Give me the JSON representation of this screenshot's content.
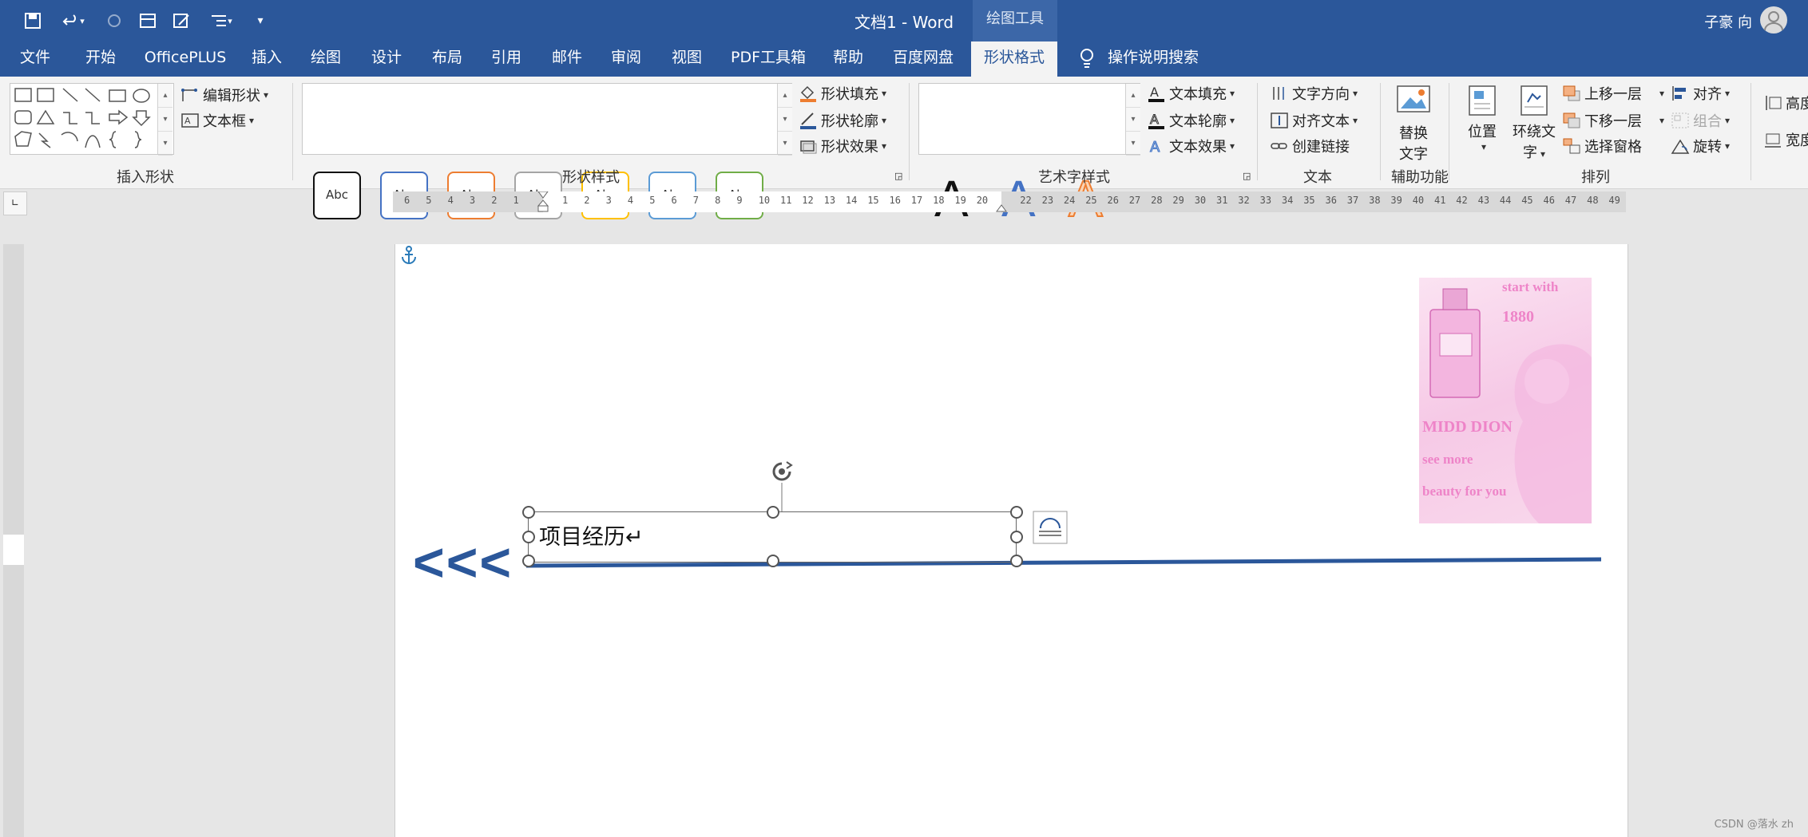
{
  "titlebar": {
    "doc_title": "文档1  -  Word",
    "context_group": "绘图工具",
    "user_name": "子豪 向",
    "qa_icons": [
      "save-icon",
      "undo-icon",
      "redo-icon",
      "table-icon",
      "edit-icon",
      "list-format-icon",
      "customize-icon"
    ]
  },
  "tabs": [
    "文件",
    "开始",
    "OfficePLUS",
    "插入",
    "绘图",
    "设计",
    "布局",
    "引用",
    "邮件",
    "审阅",
    "视图",
    "PDF工具箱",
    "帮助",
    "百度网盘",
    "形状格式"
  ],
  "active_tab": "形状格式",
  "tell_me": "操作说明搜索",
  "ribbon": {
    "insert_shapes": {
      "label": "插入形状",
      "edit_shape": "编辑形状",
      "text_box": "文本框"
    },
    "shape_styles": {
      "label": "形状样式",
      "abc": "Abc",
      "fill": "形状填充",
      "outline": "形状轮廓",
      "effects": "形状效果"
    },
    "wordart": {
      "label": "艺术字样式",
      "a": "A",
      "text_fill": "文本填充",
      "text_outline": "文本轮廓",
      "text_effects": "文本效果"
    },
    "text": {
      "label": "文本",
      "direction": "文字方向",
      "align": "对齐文本",
      "link": "创建链接"
    },
    "accessibility": {
      "label": "辅助功能",
      "alt_text_1": "替换",
      "alt_text_2": "文字"
    },
    "arrange": {
      "label": "排列",
      "position": "位置",
      "wrap_1": "环绕文",
      "wrap_2": "字",
      "bring_forward": "上移一层",
      "send_backward": "下移一层",
      "selection_pane": "选择窗格",
      "align": "对齐",
      "group": "组合",
      "rotate": "旋转"
    },
    "size": {
      "height": "高度",
      "width": "宽度"
    }
  },
  "colors": {
    "brand": "#2b579a",
    "abc_borders": [
      "#111111",
      "#4472c4",
      "#ed7d31",
      "#a5a5a5",
      "#ffc000",
      "#5b9bd5",
      "#70ad47"
    ]
  },
  "ruler_left": [
    "6",
    "5",
    "4",
    "3",
    "2",
    "1"
  ],
  "ruler_right": [
    "1",
    "2",
    "3",
    "4",
    "5",
    "6",
    "7",
    "8",
    "9",
    "10",
    "11",
    "12",
    "13",
    "14",
    "15",
    "16",
    "17",
    "18",
    "19",
    "20",
    "22",
    "23",
    "24",
    "25",
    "26",
    "27",
    "28",
    "29",
    "30",
    "31",
    "32",
    "33",
    "34",
    "35",
    "36",
    "37",
    "38",
    "39",
    "40",
    "41",
    "42",
    "43",
    "44",
    "45",
    "46",
    "47",
    "48",
    "49"
  ],
  "document": {
    "textbox_text": "项目经历↵",
    "arrows": "<<<",
    "image_text": {
      "t1": "start with",
      "t2": "1880",
      "t3": "MIDD DION",
      "t4": "see more",
      "t5": "beauty for you"
    }
  },
  "watermark": "CSDN @落水 zh"
}
